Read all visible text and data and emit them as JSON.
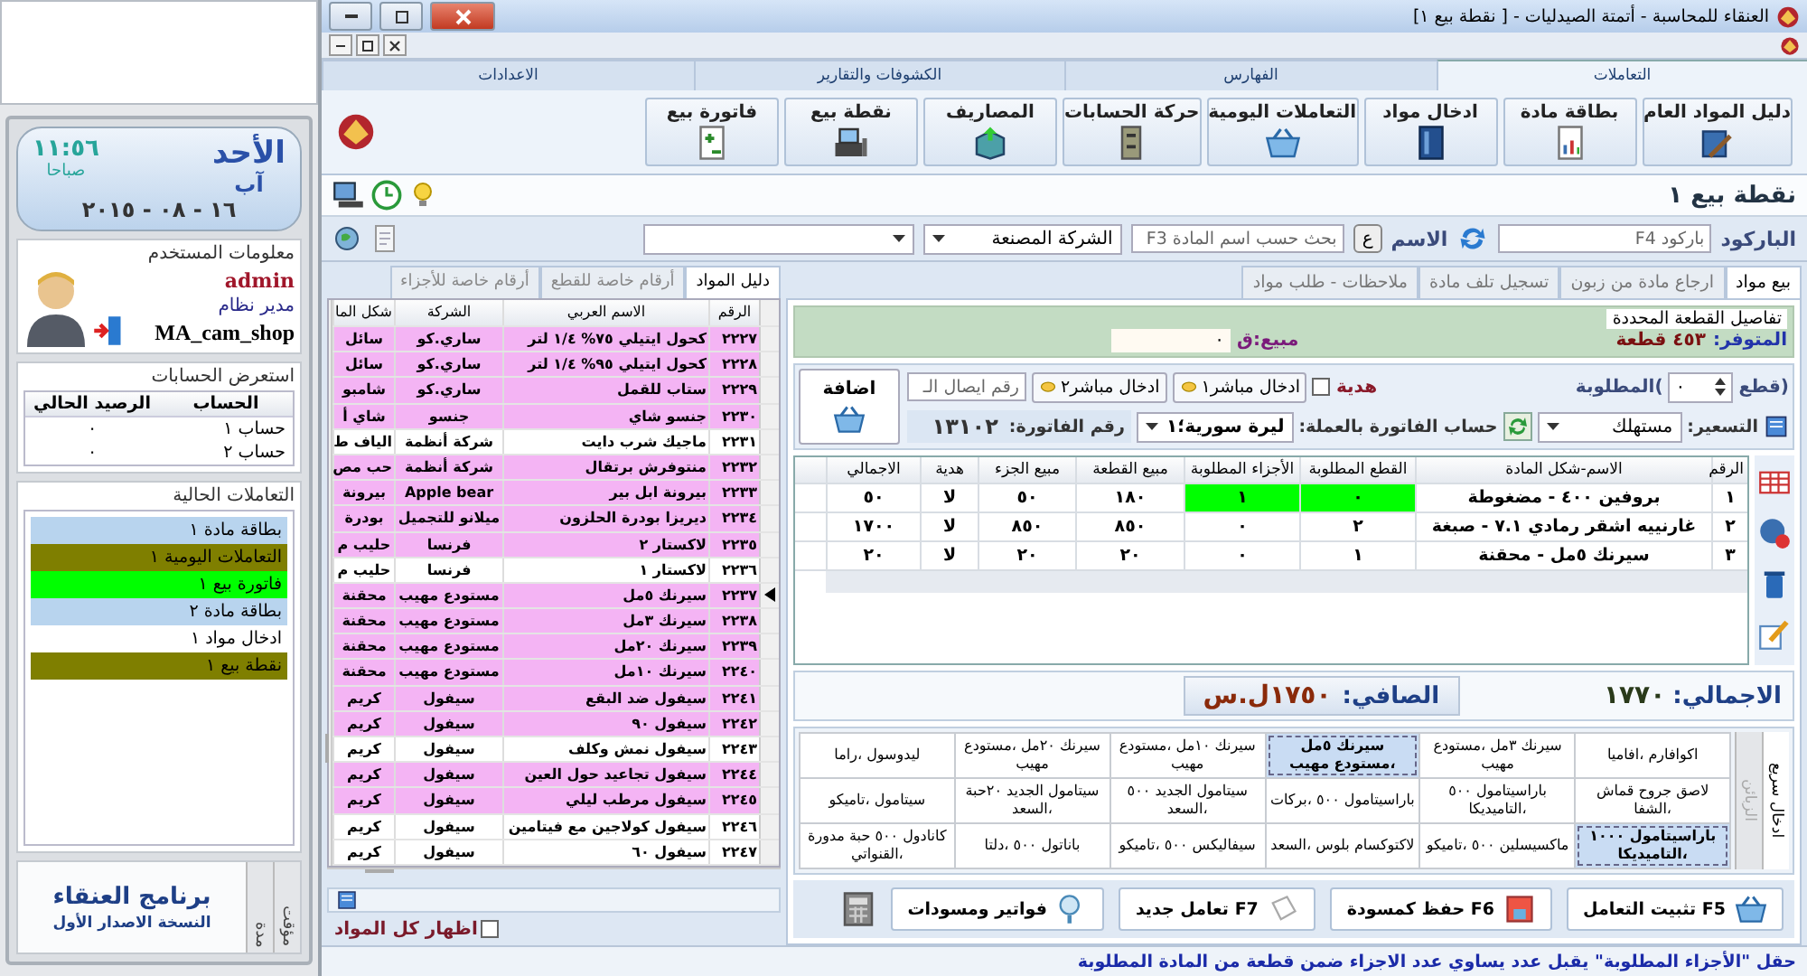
{
  "side": {
    "clock": {
      "day": "الأحد",
      "month": "آب",
      "time": "١١:٥٦",
      "period": "صباحا",
      "date": "٢٠١٥ - ٠٨ - ١٦"
    },
    "user": {
      "title": "معلومات المستخدم",
      "name": "admin",
      "role": "مدير نظام",
      "shop": "MA_cam_shop"
    },
    "accounts": {
      "title": "استعرض الحسابات",
      "columns": [
        "الحساب",
        "الرصيد الحالي"
      ],
      "rows": [
        [
          "حساب ١",
          "٠"
        ],
        [
          "حساب ٢",
          "٠"
        ]
      ]
    },
    "transactions": {
      "title": "التعاملات الحالية",
      "items": [
        {
          "label": "بطاقة مادة ١",
          "color": "#b8d4ee"
        },
        {
          "label": "التعاملات اليومية ١",
          "color": "#7f7f00"
        },
        {
          "label": "فاتورة بيع ١",
          "color": "#00ff00"
        },
        {
          "label": "بطاقة مادة ٢",
          "color": "#b8d4ee"
        },
        {
          "label": "ادخال مواد ١",
          "color": "#ffffff"
        },
        {
          "label": "نقطة بيع ١",
          "color": "#7f7f00"
        }
      ]
    },
    "footer": {
      "app": "برنامج العنقاء",
      "version": "النسخة الاصدار الأول",
      "tabs": [
        {
          "label": "مؤقت",
          "selected": false
        },
        {
          "label": "مدة",
          "selected": false
        }
      ]
    }
  },
  "window": {
    "title": "العنقاء للمحاسبة - أتمتة الصيدليات - [ نقطة بيع ١]"
  },
  "ribbon": {
    "tabs": [
      {
        "label": "التعاملات",
        "selected": true
      },
      {
        "label": "الفهارس",
        "selected": false
      },
      {
        "label": "الكشوفات والتقارير",
        "selected": false
      },
      {
        "label": "الاعدادات",
        "selected": false
      }
    ],
    "buttons": [
      "دليل المواد العام",
      "بطاقة مادة",
      "ادخال مواد",
      "التعاملات اليومية",
      "حركة الحسابات",
      "المصاريف",
      "نقطة بيع",
      "فاتورة بيع"
    ]
  },
  "document_title": "نقطة بيع ١",
  "search": {
    "barcode_label": "الباركود",
    "barcode_placeholder": "باركود F4",
    "name_label": "الاسم",
    "letter_button": "ع",
    "name_placeholder": "بحث حسب اسم المادة F3",
    "company": "الشركة المصنعة"
  },
  "materials": {
    "tabs": [
      {
        "label": "دليل المواد",
        "selected": true
      },
      {
        "label": "أرقام خاصة للقطع",
        "selected": false
      },
      {
        "label": "أرقام خاصة للأجزاء",
        "selected": false
      }
    ],
    "columns": [
      "الرقم",
      "الاسم العربي",
      "الشركة",
      "شكل الما"
    ],
    "rows": [
      {
        "cells": [
          "٢٢٢٧",
          "كحول ايتيلي ٧٥% ١/٤ لتر",
          "ساري.كو",
          "سائل"
        ],
        "highlighted": true,
        "current": false
      },
      {
        "cells": [
          "٢٢٢٨",
          "كحول ايتيلي ٩٥% ١/٤ لتر",
          "ساري.كو",
          "سائل"
        ],
        "highlighted": true,
        "current": false
      },
      {
        "cells": [
          "٢٢٢٩",
          "ستاب للقمل",
          "ساري.كو",
          "شامبو"
        ],
        "highlighted": true,
        "current": false
      },
      {
        "cells": [
          "٢٢٣٠",
          "جنسو شاي",
          "جنسو",
          "شاي أ"
        ],
        "highlighted": true,
        "current": false
      },
      {
        "cells": [
          "٢٢٣١",
          "ماجيك شرب دايت",
          "شركة أنظمة",
          "الياف ط"
        ],
        "highlighted": false,
        "current": false
      },
      {
        "cells": [
          "٢٢٣٢",
          "منتوفرش برتقال",
          "شركة أنظمة",
          "حب مص"
        ],
        "highlighted": true,
        "current": false
      },
      {
        "cells": [
          "٢٢٣٣",
          "بيرونة ابل بير",
          "Apple bear",
          "بيرونة"
        ],
        "highlighted": true,
        "current": false
      },
      {
        "cells": [
          "٢٢٣٤",
          "ديريزا بودرة الحلزون",
          "ميلانو للتجميل",
          "بودرة"
        ],
        "highlighted": true,
        "current": false
      },
      {
        "cells": [
          "٢٢٣٥",
          "لاكستار ٢",
          "فرنسا",
          "حليب م"
        ],
        "highlighted": true,
        "current": false
      },
      {
        "cells": [
          "٢٢٣٦",
          "لاكستار ١",
          "فرنسا",
          "حليب م"
        ],
        "highlighted": false,
        "current": false
      },
      {
        "cells": [
          "٢٢٣٧",
          "سيرنك ٥مل",
          "مستودع مهيب",
          "محقنة"
        ],
        "highlighted": true,
        "current": true
      },
      {
        "cells": [
          "٢٢٣٨",
          "سيرنك ٣مل",
          "مستودع مهيب",
          "محقنة"
        ],
        "highlighted": true,
        "current": false
      },
      {
        "cells": [
          "٢٢٣٩",
          "سيرنك ٢٠مل",
          "مستودع مهيب",
          "محقنة"
        ],
        "highlighted": true,
        "current": false
      },
      {
        "cells": [
          "٢٢٤٠",
          "سيرنك ١٠مل",
          "مستودع مهيب",
          "محقنة"
        ],
        "highlighted": true,
        "current": false
      },
      {
        "cells": [
          "٢٢٤١",
          "سيفول ضد البقع",
          "سيفول",
          "كريم"
        ],
        "highlighted": true,
        "current": false
      },
      {
        "cells": [
          "٢٢٤٢",
          "سيفول ٩٠",
          "سيفول",
          "كريم"
        ],
        "highlighted": true,
        "current": false
      },
      {
        "cells": [
          "٢٢٤٣",
          "سيفول نمش وكلف",
          "سيفول",
          "كريم"
        ],
        "highlighted": false,
        "current": false
      },
      {
        "cells": [
          "٢٢٤٤",
          "سيفول تجاعيد حول العين",
          "سيفول",
          "كريم"
        ],
        "highlighted": true,
        "current": false
      },
      {
        "cells": [
          "٢٢٤٥",
          "سيفول مرطب ليلي",
          "سيفول",
          "كريم"
        ],
        "highlighted": true,
        "current": false
      },
      {
        "cells": [
          "٢٢٤٦",
          "سيفول كولاجين مع فيتامين",
          "سيفول",
          "كريم"
        ],
        "highlighted": false,
        "current": false
      },
      {
        "cells": [
          "٢٢٤٧",
          "سيفول ٦٠",
          "سيفول",
          "كريم"
        ],
        "highlighted": false,
        "current": false
      }
    ],
    "show_all": {
      "label": "اظهار كل المواد",
      "checked": false
    }
  },
  "sale": {
    "tabs": [
      {
        "label": "بيع مواد",
        "selected": true
      },
      {
        "label": "ارجاع مادة من زبون",
        "selected": false
      },
      {
        "label": "تسجيل تلف مادة",
        "selected": false
      },
      {
        "label": "ملاحظات - طلب مواد",
        "selected": false
      }
    ],
    "details": {
      "title": "تفاصيل القطعة المحددة",
      "available_label": "المتوفر:",
      "available": "٤٥٣ قطعة",
      "price_label": "مبيع:ق",
      "price": "٠"
    },
    "quantity": {
      "label_right": "(قطع",
      "value": "٠",
      "label_left": ")المطلوبة"
    },
    "gift": {
      "label": "هدية",
      "checked": false
    },
    "direct_buttons": [
      "ادخال مباشر١",
      "ادخال مباشر٢"
    ],
    "receipt_placeholder": "رقم ايصال الـ",
    "add_button": "اضافة",
    "pricing_label": "التسعير:",
    "pricing": "مستهلك",
    "currency_label": "حساب الفاتورة بالعملة:",
    "currency": "ليرة سورية؛١",
    "invoice_label": "رقم الفاتورة:",
    "invoice_number": "١٣١٠٢",
    "table": {
      "columns": [
        "الرقم",
        "الاسم-شكل المادة",
        "القطع المطلوبة",
        "الأجزاء المطلوبة",
        "مبيع القطعة",
        "مبيع الجزء",
        "هدية",
        "الاجمالي"
      ],
      "rows": [
        {
          "cells": [
            "١",
            "بروفين ٤٠٠ - مضغوطة",
            "٠",
            "١",
            "١٨٠",
            "٥٠",
            "لا",
            "٥٠"
          ],
          "highlighted": true
        },
        {
          "cells": [
            "٢",
            "غارنييه اشقر رمادي ٧.١ - صبغة",
            "٢",
            "٠",
            "٨٥٠",
            "٨٥٠",
            "لا",
            "١٧٠٠"
          ],
          "highlighted": false
        },
        {
          "cells": [
            "٣",
            "سيرنك ٥مل - محقنة",
            "١",
            "٠",
            "٢٠",
            "٢٠",
            "لا",
            "٢٠"
          ],
          "highlighted": false
        }
      ]
    },
    "total_label": "الاجمالي:",
    "total": "١٧٧٠",
    "net_label": "الصافي:",
    "net": "١٧٥٠ل.س",
    "quick": {
      "tabs": [
        {
          "label": "ادخال سريع",
          "selected": true
        },
        {
          "label": "الزبائن",
          "selected": false
        }
      ],
      "items": [
        {
          "label": "اكوافارم ،افاميا",
          "selected": false
        },
        {
          "label": "سيرنك ٣مل ،مستودع مهيب",
          "selected": false
        },
        {
          "label": "سيرنك ٥مل ،مستودع مهيب",
          "selected": true
        },
        {
          "label": "سيرنك ١٠مل ،مستودع مهيب",
          "selected": false
        },
        {
          "label": "سيرنك ٢٠مل ،مستودع مهيب",
          "selected": false
        },
        {
          "label": "ليدوسول ،راما",
          "selected": false
        },
        {
          "label": "لاصق جروح قماش ،الشفا",
          "selected": false
        },
        {
          "label": "باراسيتامول ٥٠٠ ،التاميديكا",
          "selected": false
        },
        {
          "label": "باراسيتامول ٥٠٠ ،بركات",
          "selected": false
        },
        {
          "label": "سيتامول الجديد ٥٠٠ ،السعد",
          "selected": false
        },
        {
          "label": "سيتامول الجديد ٢٠حبة ،السعد",
          "selected": false
        },
        {
          "label": "سيتامول ،تاميكو",
          "selected": false
        },
        {
          "label": "باراسيتامول ١٠٠٠ ،التاميديكا",
          "selected": true
        },
        {
          "label": "ماكسيسلين ٥٠٠ ،تاميكو",
          "selected": false
        },
        {
          "label": "لاكتوكسام بلوس ،السعد",
          "selected": false
        },
        {
          "label": "سيفاليكس ٥٠٠ ،تاميكو",
          "selected": false
        },
        {
          "label": "باناتول ٥٠٠ ،دلتا",
          "selected": false
        },
        {
          "label": "كانادول ٥٠٠ حبة مدورة ،القنواتي",
          "selected": false
        }
      ]
    },
    "actions": [
      "F5 تثبيت التعامل",
      "F6 حفظ كمسودة",
      "F7 تعامل جديد",
      "فواتير ومسودات"
    ]
  },
  "status_bar": "حقل \"الأجزاء المطلوبة\" يقبل عدد يساوي عدد الاجزاء ضمن قطعة من المادة المطلوبة"
}
